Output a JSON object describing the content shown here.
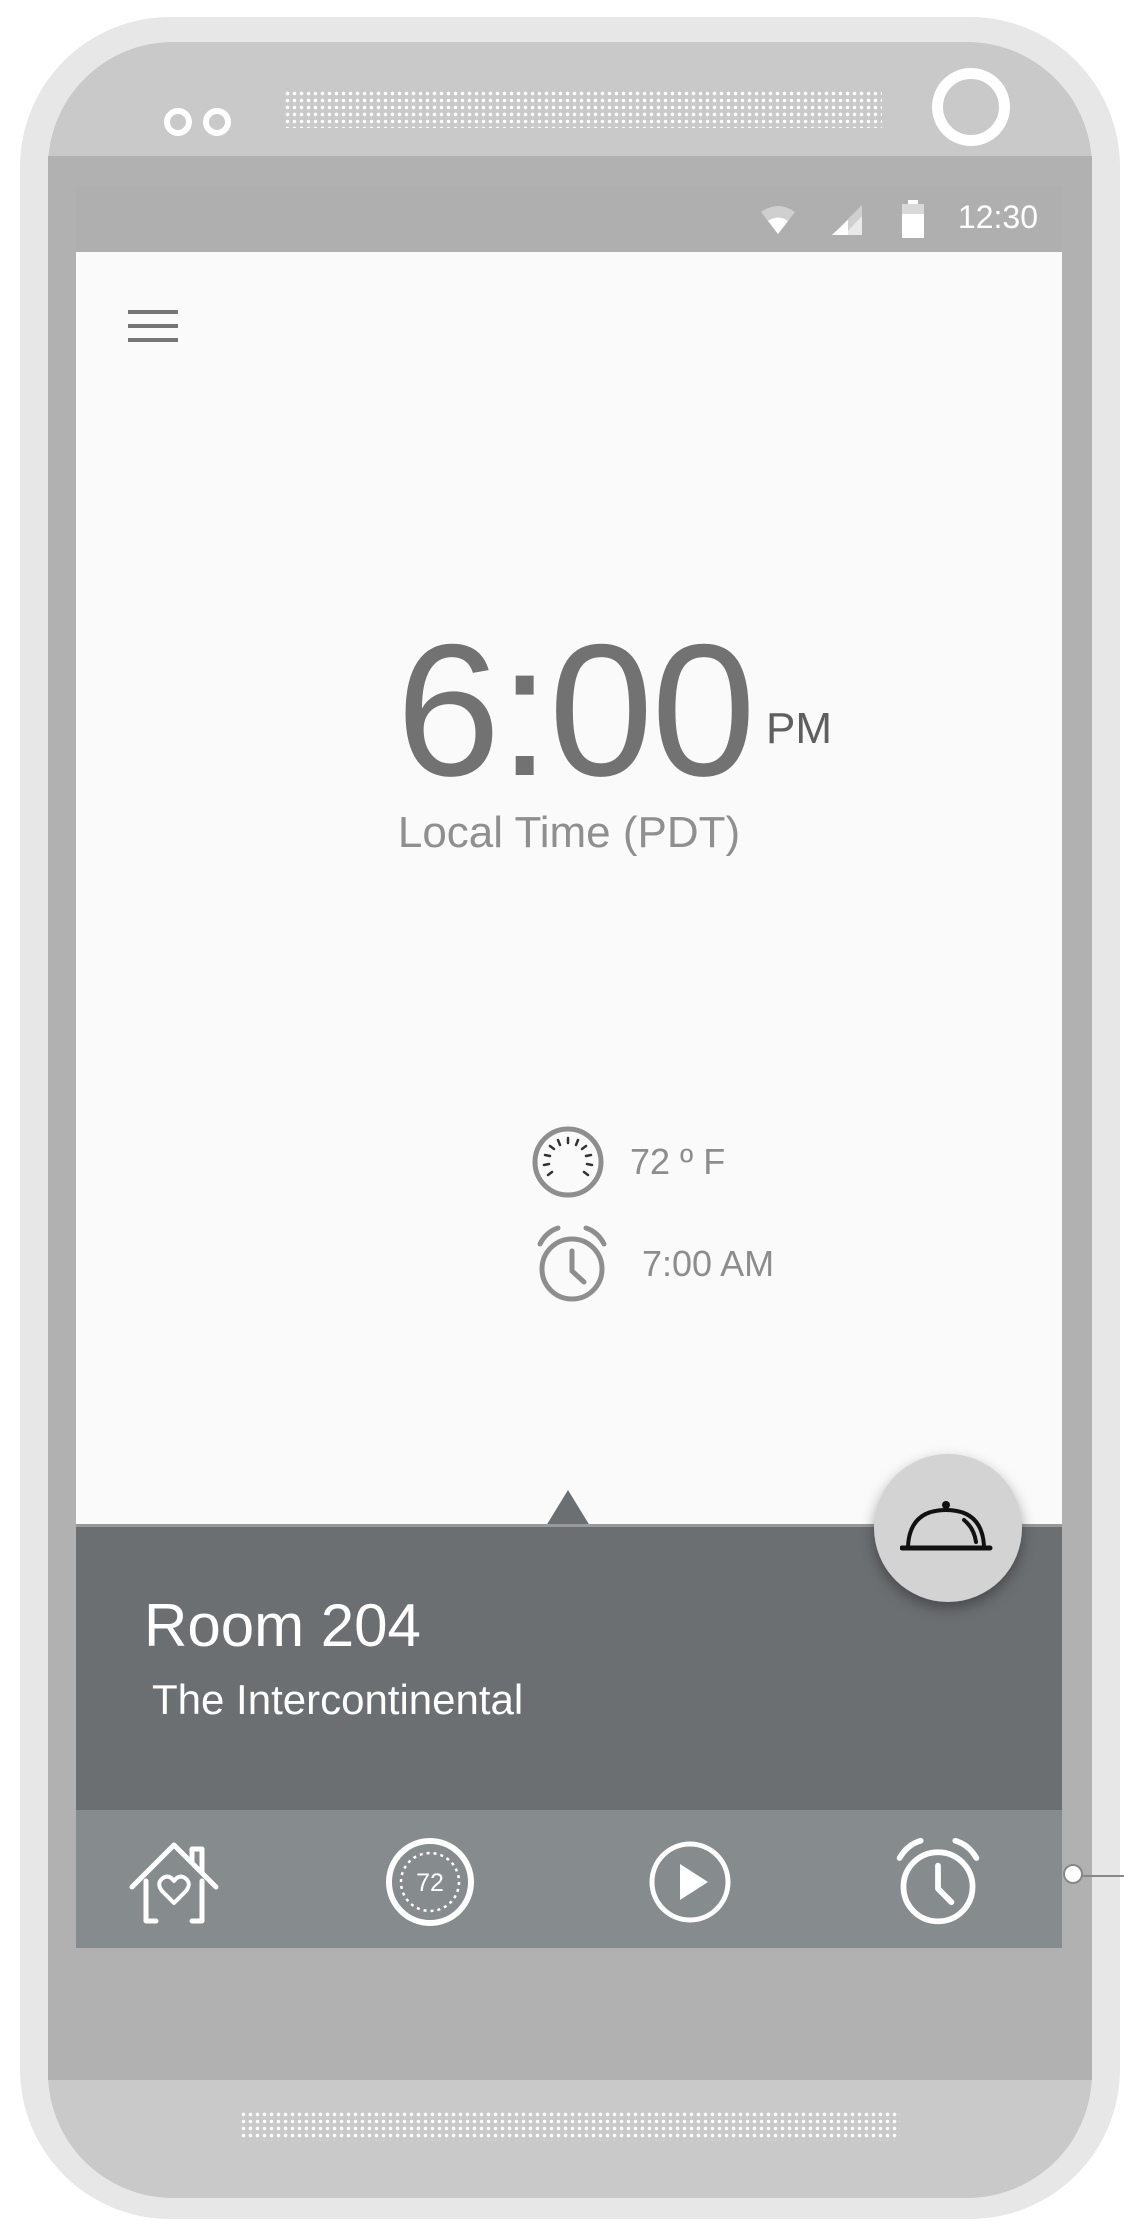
{
  "status_bar": {
    "time": "12:30",
    "icons": [
      "wifi-icon",
      "signal-icon",
      "battery-icon"
    ]
  },
  "header": {
    "menu_icon": "hamburger-menu-icon"
  },
  "clock": {
    "time": "6:00",
    "period": "PM",
    "timezone_label": "Local Time (PDT)"
  },
  "info": {
    "temperature": "72 º F",
    "alarm": "7:00 AM"
  },
  "room": {
    "title": "Room 204",
    "hotel": "The Intercontinental",
    "fab_icon": "room-service-cloche-icon"
  },
  "bottom_nav": {
    "items": [
      {
        "icon": "home-heart-icon"
      },
      {
        "icon": "thermostat-icon",
        "label": "72"
      },
      {
        "icon": "play-icon"
      },
      {
        "icon": "alarm-clock-icon"
      }
    ]
  },
  "colors": {
    "status_bar": "#afafaf",
    "screen_bg": "#fafafa",
    "room_panel": "#6c6f72",
    "bottom_nav": "#868b8e",
    "fab": "#d3d3d3"
  }
}
